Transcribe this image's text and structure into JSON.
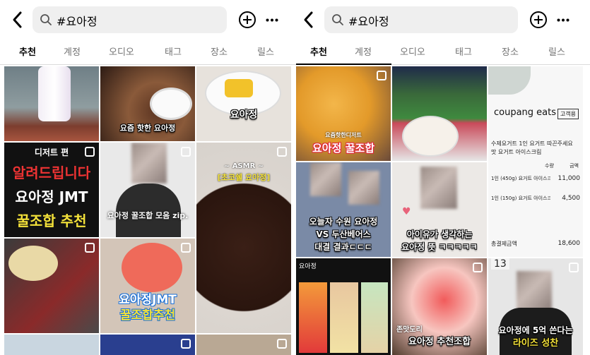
{
  "search": {
    "query": "#요아정"
  },
  "tabs": [
    "추천",
    "계정",
    "오디오",
    "태그",
    "장소",
    "릴스"
  ],
  "active_tab": "추천",
  "left_tiles": {
    "t2_caption": "디저트 편",
    "t2_line1": "알려드립니다",
    "t2_line2": "요아정 JMT",
    "t2_line3": "꿀조합 추천",
    "t1_caption": "요즘 핫한 요아정",
    "t3_caption": "요아정",
    "t5_line1": "요아정 꿀조합 모음 zip.",
    "t6_asmr": "~ ASMR ~",
    "t6_title": "[초코쉘 요아정]",
    "t8_line1": "요아정JMT",
    "t8_line2": "꿀조합추천"
  },
  "right_tiles": {
    "r1_tag": "요즘핫한디저트",
    "r1_title": "요아정 꿀조합",
    "r3_brand": "coupang eats",
    "r3_badge": "고객용",
    "r3_line1": "수제요거트 1인 요거트 따끈주세요",
    "r3_line2": "맛 요거트 아이스크림",
    "r3_col1": "수량",
    "r3_col2": "금액",
    "r3_item1": "1인 (450g) 요거트 아이스크림",
    "r3_item1_price": "11,000",
    "r3_item2": "1인 (150g) 요거트 아이스크림",
    "r3_item2_price": "4,500",
    "r3_total_label": "총결제금액",
    "r3_total": "18,600",
    "r3_order_no": "13",
    "r4_line1": "오늘자 수원 요아정",
    "r4_line2": "VS 두산베어스",
    "r4_line3": "대결 결과ㄷㄷㄷ",
    "r5_line1": "아이유가 생각하는",
    "r5_line2": "요아정 뜻 ㅋㅋㅋㅋㅋ",
    "r7_search": "요아정",
    "r8_caption": "존맛도리",
    "r8_title": "요아정 추천조합",
    "r9_line1": "요아정에 5억 쓴다는",
    "r9_line2": "라이즈 성찬"
  }
}
